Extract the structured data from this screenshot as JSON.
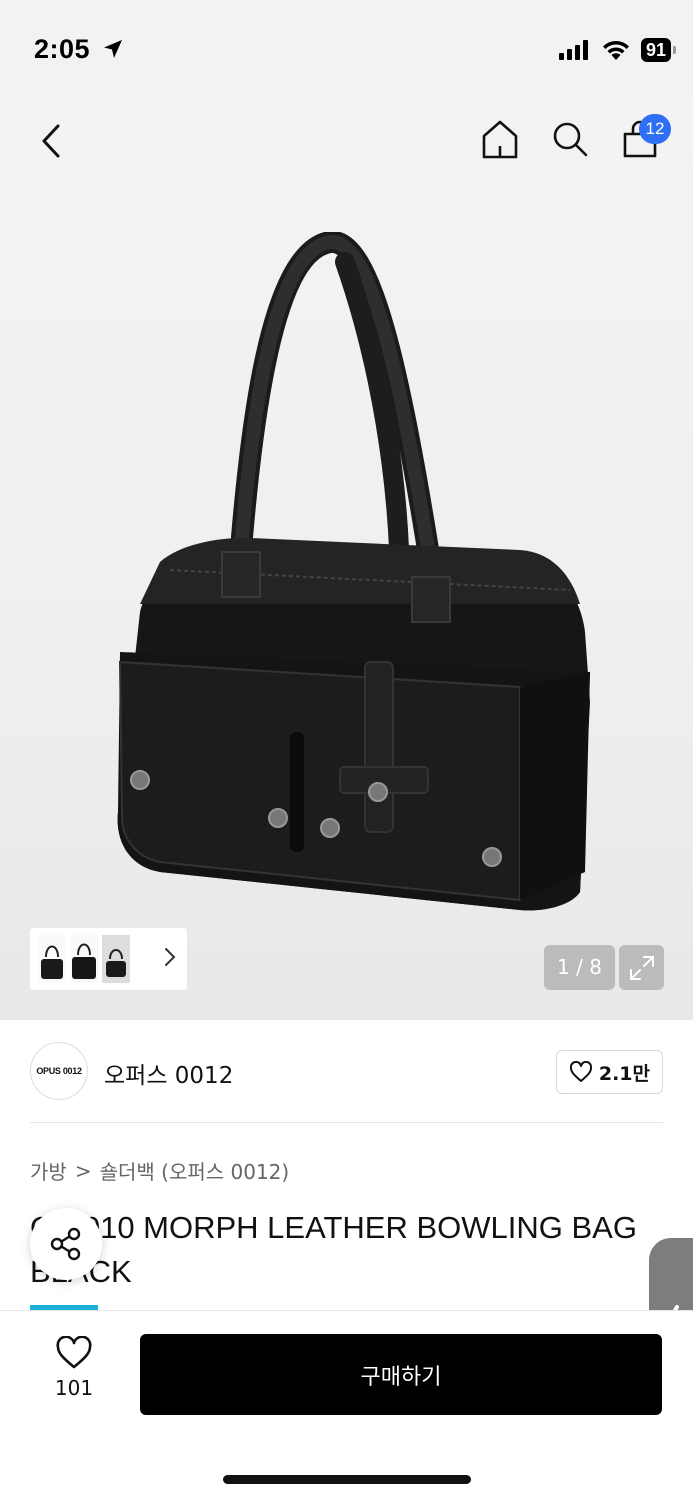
{
  "status_bar": {
    "time": "2:05",
    "battery": "91"
  },
  "header": {
    "cart_count": "12"
  },
  "gallery": {
    "page_indicator": "1 / 8"
  },
  "brand": {
    "logo_text": "OPUS 0012",
    "name": "오퍼스 0012",
    "likes": "2.1만"
  },
  "breadcrumb": {
    "level1": "가방",
    "separator": ">",
    "level2": "숄더백 (오퍼스 0012)"
  },
  "product": {
    "title": "OP 010 MORPH LEATHER BOWLING BAG BLACK"
  },
  "bottom_bar": {
    "wish_count": "101",
    "buy_label": "구매하기"
  },
  "icons": [
    "location-arrow-icon",
    "signal-icon",
    "wifi-icon",
    "back-icon",
    "home-icon",
    "search-icon",
    "cart-icon",
    "chevron-right-icon",
    "expand-icon",
    "heart-icon",
    "share-icon"
  ],
  "colors": {
    "badge": "#2f6ff5",
    "buy_button": "#000000",
    "accent": "#1bb0d8"
  }
}
